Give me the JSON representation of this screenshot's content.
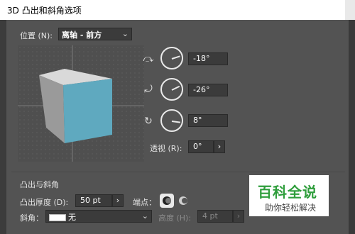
{
  "window": {
    "title": "3D 凸出和斜角选项"
  },
  "position": {
    "label": "位置 (N):",
    "value": "离轴 - 前方",
    "rotations": [
      {
        "axis_icon": "rotate-x-icon",
        "value": "-18°",
        "angle_deg": -18
      },
      {
        "axis_icon": "rotate-y-icon",
        "value": "-26°",
        "angle_deg": -26
      },
      {
        "axis_icon": "rotate-z-icon",
        "value": "8°",
        "angle_deg": 8
      }
    ],
    "perspective_label": "透视 (R):",
    "perspective_value": "0°",
    "cube_front_color": "#5fa9bf"
  },
  "extrude": {
    "section_title": "凸出与斜角",
    "depth_label": "凸出厚度 (D):",
    "depth_value": "50 pt",
    "cap_label": "端点：",
    "bevel_label": "斜角：",
    "bevel_value": "无",
    "height_label": "高度 (H):",
    "height_value": "4 pt"
  },
  "watermark": {
    "title": "百科全说",
    "subtitle": "助你轻松解决"
  }
}
